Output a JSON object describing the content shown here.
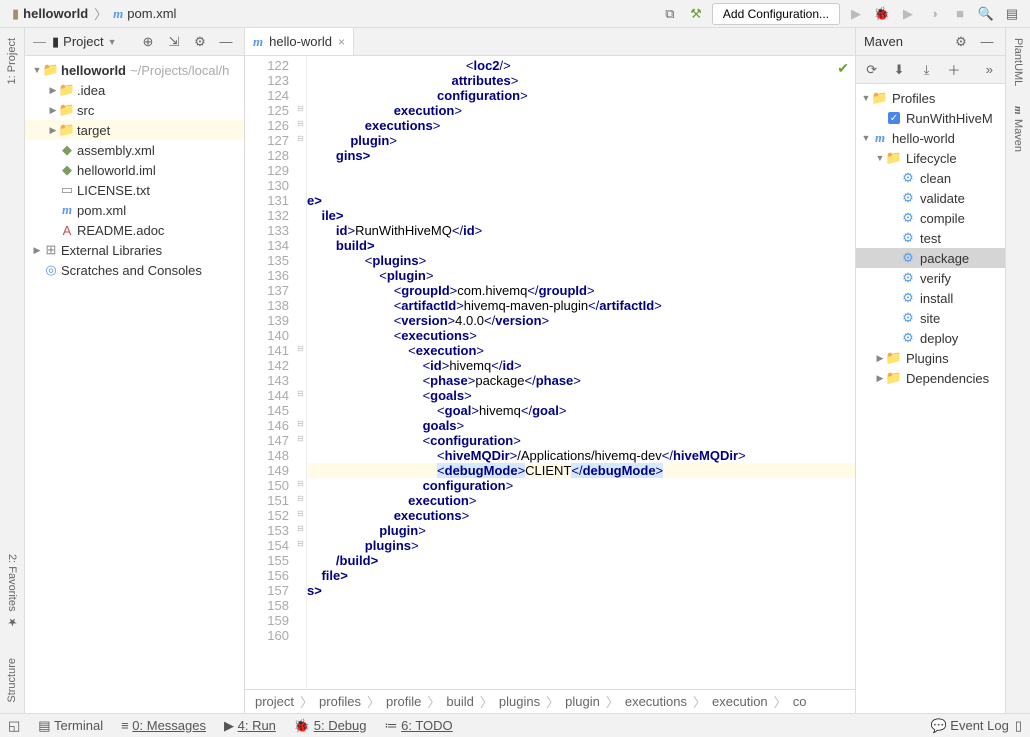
{
  "breadcrumb": {
    "root": "helloworld",
    "file": "pom.xml"
  },
  "topbar": {
    "config_btn": "Add Configuration..."
  },
  "left_tabs": {
    "project": "1: Project",
    "favorites": "2: Favorites",
    "structure": "Structure"
  },
  "right_tabs": {
    "plantuml": "PlantUML",
    "maven": "Maven"
  },
  "project": {
    "header": "Project",
    "root": "helloworld",
    "root_path": "~/Projects/local/h",
    "items": [
      {
        "ind": 1,
        "exp": "▶",
        "ic": "folder",
        "label": ".idea"
      },
      {
        "ind": 1,
        "exp": "▶",
        "ic": "folder",
        "label": "src"
      },
      {
        "ind": 1,
        "exp": "▶",
        "ic": "folder-orange",
        "label": "target",
        "sel": true
      },
      {
        "ind": 1,
        "exp": "",
        "ic": "xml",
        "label": "assembly.xml"
      },
      {
        "ind": 1,
        "exp": "",
        "ic": "iml",
        "label": "helloworld.iml"
      },
      {
        "ind": 1,
        "exp": "",
        "ic": "file",
        "label": "LICENSE.txt"
      },
      {
        "ind": 1,
        "exp": "",
        "ic": "m",
        "label": "pom.xml"
      },
      {
        "ind": 1,
        "exp": "",
        "ic": "adoc",
        "label": "README.adoc"
      }
    ],
    "ext_lib": "External Libraries",
    "scratches": "Scratches and Consoles"
  },
  "editor": {
    "tab": "hello-world",
    "bottom_bc": [
      "project",
      "profiles",
      "profile",
      "build",
      "plugins",
      "plugin",
      "executions",
      "execution",
      "co"
    ],
    "lines": [
      {
        "n": 122,
        "pad": 44,
        "t": "<",
        "tag": "loc2",
        "c": "/>"
      },
      {
        "n": 123,
        "pad": 40,
        "t": "</",
        "tag": "attributes",
        "c": ">"
      },
      {
        "n": 124,
        "pad": 36,
        "t": "</",
        "tag": "configuration",
        "c": ">"
      },
      {
        "n": 125,
        "pad": 24,
        "t": "</",
        "tag": "execution",
        "c": ">"
      },
      {
        "n": 126,
        "pad": 16,
        "t": "</",
        "tag": "executions",
        "c": ">"
      },
      {
        "n": 127,
        "pad": 12,
        "t": "</",
        "tag": "plugin",
        "c": ">"
      },
      {
        "n": 128,
        "pad": 8,
        "raw": "gins>"
      },
      {
        "n": 129,
        "pad": 0,
        "raw": ""
      },
      {
        "n": 130,
        "pad": 0,
        "raw": ""
      },
      {
        "n": 131,
        "pad": 0,
        "raw": "e>"
      },
      {
        "n": 132,
        "pad": 4,
        "raw": "ile>"
      },
      {
        "n": 133,
        "pad": 8,
        "raw2": "id",
        "txt": "RunWithHiveMQ"
      },
      {
        "n": 134,
        "pad": 8,
        "raw": "build>"
      },
      {
        "n": 135,
        "pad": 16,
        "t": "<",
        "tag": "plugins",
        "c": ">"
      },
      {
        "n": 136,
        "pad": 20,
        "t": "<",
        "tag": "plugin",
        "c": ">"
      },
      {
        "n": 137,
        "pad": 24,
        "full": "group",
        "txt": "com.hivemq"
      },
      {
        "n": 138,
        "pad": 24,
        "full": "artifactId",
        "txt": "hivemq-maven-plugin"
      },
      {
        "n": 139,
        "pad": 24,
        "full": "version",
        "txt": "4.0.0"
      },
      {
        "n": 140,
        "pad": 24,
        "t": "<",
        "tag": "executions",
        "c": ">"
      },
      {
        "n": 141,
        "pad": 28,
        "t": "<",
        "tag": "execution",
        "c": ">"
      },
      {
        "n": 142,
        "pad": 32,
        "full": "id",
        "txt": "hivemq"
      },
      {
        "n": 143,
        "pad": 32,
        "full": "phase",
        "txt": "package"
      },
      {
        "n": 144,
        "pad": 32,
        "t": "<",
        "tag": "goals",
        "c": ">"
      },
      {
        "n": 145,
        "pad": 36,
        "full": "goal",
        "txt": "hivemq"
      },
      {
        "n": 146,
        "pad": 32,
        "t": "</",
        "tag": "goals",
        "c": ">"
      },
      {
        "n": 147,
        "pad": 32,
        "t": "<",
        "tag": "configuration",
        "c": ">"
      },
      {
        "n": 148,
        "pad": 36,
        "full": "hiveMQDir",
        "txt": "/Applications/hivemq-dev"
      },
      {
        "n": 149,
        "pad": 36,
        "full": "debugMode",
        "txt": "CLIENT",
        "hl": true,
        "sel": true
      },
      {
        "n": 150,
        "pad": 32,
        "t": "</",
        "tag": "configuration",
        "c": ">"
      },
      {
        "n": 151,
        "pad": 28,
        "t": "</",
        "tag": "execution",
        "c": ">"
      },
      {
        "n": 152,
        "pad": 24,
        "t": "</",
        "tag": "executions",
        "c": ">"
      },
      {
        "n": 153,
        "pad": 20,
        "t": "</",
        "tag": "plugin",
        "c": ">"
      },
      {
        "n": 154,
        "pad": 16,
        "t": "</",
        "tag": "plugins",
        "c": ">"
      },
      {
        "n": 155,
        "pad": 8,
        "raw": "/build>"
      },
      {
        "n": 156,
        "pad": 4,
        "raw": "file>"
      },
      {
        "n": 157,
        "pad": 0,
        "raw": "s>"
      },
      {
        "n": 158,
        "pad": 0,
        "raw": ""
      },
      {
        "n": 159,
        "pad": 0,
        "raw": ""
      },
      {
        "n": 160,
        "pad": 0,
        "raw": ""
      }
    ]
  },
  "maven": {
    "title": "Maven",
    "profiles": "Profiles",
    "profile_check": "RunWithHiveM",
    "project": "hello-world",
    "lifecycle": "Lifecycle",
    "goals": [
      "clean",
      "validate",
      "compile",
      "test",
      "package",
      "verify",
      "install",
      "site",
      "deploy"
    ],
    "selected_goal": "package",
    "plugins": "Plugins",
    "deps": "Dependencies"
  },
  "status": {
    "terminal": "Terminal",
    "messages": "0: Messages",
    "run": "4: Run",
    "debug": "5: Debug",
    "todo": "6: TODO",
    "event": "Event Log"
  }
}
